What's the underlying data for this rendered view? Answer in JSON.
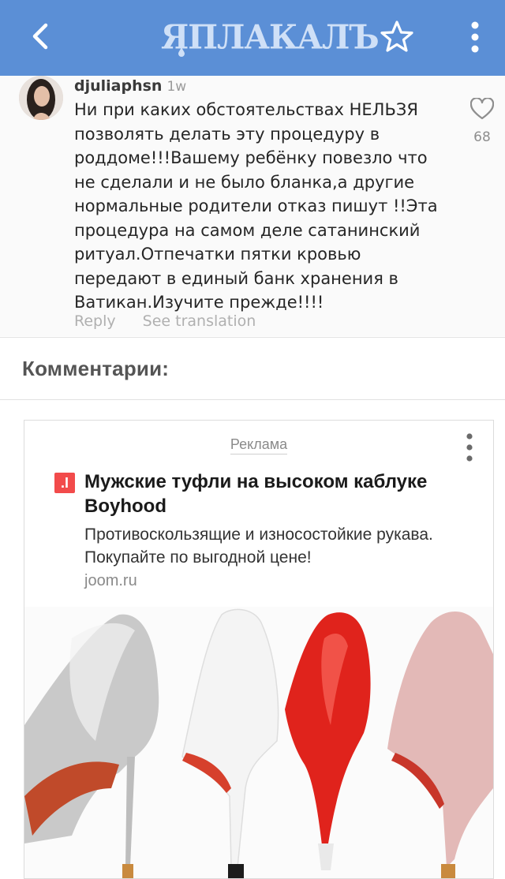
{
  "appbar": {
    "logo_text": "ЯПЛАКАЛЪ",
    "accent_color": "#5b8fd6",
    "icons": [
      "back-arrow-icon",
      "star-icon",
      "more-vertical-icon"
    ]
  },
  "ig_comment": {
    "username": "djuliaphsn",
    "time": "1w",
    "text": "Ни при каких обстоятельствах НЕЛЬЗЯ позволять делать эту процедуру в роддоме!!!Вашему ребёнку повезло что не сделали и не было бланка,а другие нормальные родители отказ пишут !!Эта процедура на самом деле сатанинский ритуал.Отпечатки пятки кровью передают в единый банк хранения в Ватикан.Изучите прежде!!!!",
    "likes": "68",
    "reply_label": "Reply",
    "translate_label": "See translation"
  },
  "comments": {
    "title": "Комментарии:"
  },
  "ad": {
    "label": "Реклама",
    "brand_badge": ".I",
    "title": "Мужские туфли на высоком каблуке Boyhood",
    "description": "Противоскользящие и износостойкие рукава. Покупайте по выгодной цене!",
    "domain": "joom.ru"
  }
}
